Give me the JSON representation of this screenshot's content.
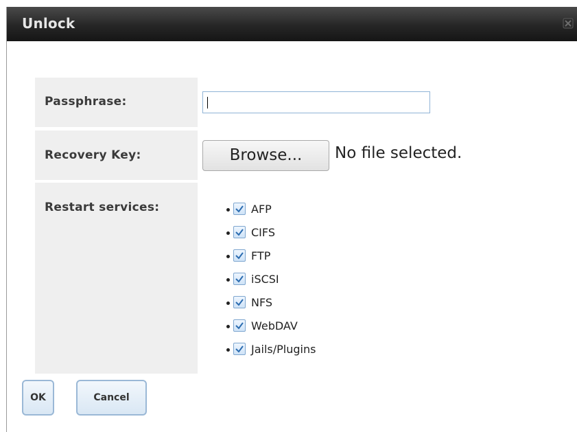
{
  "dialog": {
    "title": "Unlock",
    "close_icon": "close-icon"
  },
  "form": {
    "passphrase": {
      "label": "Passphrase:",
      "value": ""
    },
    "recovery_key": {
      "label": "Recovery Key:",
      "browse_label": "Browse...",
      "file_status": "No file selected."
    },
    "restart_services": {
      "label": "Restart services:",
      "items": [
        {
          "label": "AFP",
          "checked": true
        },
        {
          "label": "CIFS",
          "checked": true
        },
        {
          "label": "FTP",
          "checked": true
        },
        {
          "label": "iSCSI",
          "checked": true
        },
        {
          "label": "NFS",
          "checked": true
        },
        {
          "label": "WebDAV",
          "checked": true
        },
        {
          "label": "Jails/Plugins",
          "checked": true
        }
      ]
    }
  },
  "actions": {
    "ok_label": "OK",
    "cancel_label": "Cancel"
  },
  "colors": {
    "titlebar": "#262626",
    "label_bg": "#efefef",
    "accent": "#9ab8d6"
  }
}
